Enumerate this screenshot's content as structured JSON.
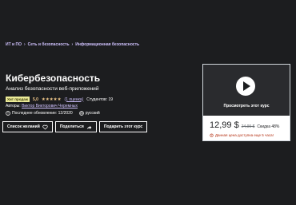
{
  "breadcrumb": {
    "items": [
      "ИТ и ПО",
      "Сеть и безопасность",
      "Информационная безопасность"
    ],
    "separator": "›"
  },
  "course": {
    "title": "Кибербезопасность",
    "subtitle": "Анализ безопасности веб-приложений",
    "badge": "Хит продаж",
    "rating": "5,0",
    "stars": "★★★★★",
    "ratings_count": "(1 оценка)",
    "students": "Студентов: 19",
    "authors_label": "Авторы:",
    "author": "Виктор Викторович Черемных",
    "last_updated": "Последнее обновление: 12/2020",
    "language": "русский"
  },
  "buttons": {
    "wishlist": "Список желаний",
    "share": "Поделиться",
    "gift": "Подарить этот курс"
  },
  "card": {
    "preview_label": "Просмотреть этот курс",
    "price": "12,99 $",
    "old_price": "24,99 $",
    "discount": "Скидка 48%",
    "timer": "Данная цена доступна еще 5 часа!"
  },
  "colors": {
    "background": "#1c1d1f",
    "link": "#cec0fc",
    "star": "#f3ca8c",
    "badge": "#eceb98",
    "timer": "#b32d0f"
  }
}
